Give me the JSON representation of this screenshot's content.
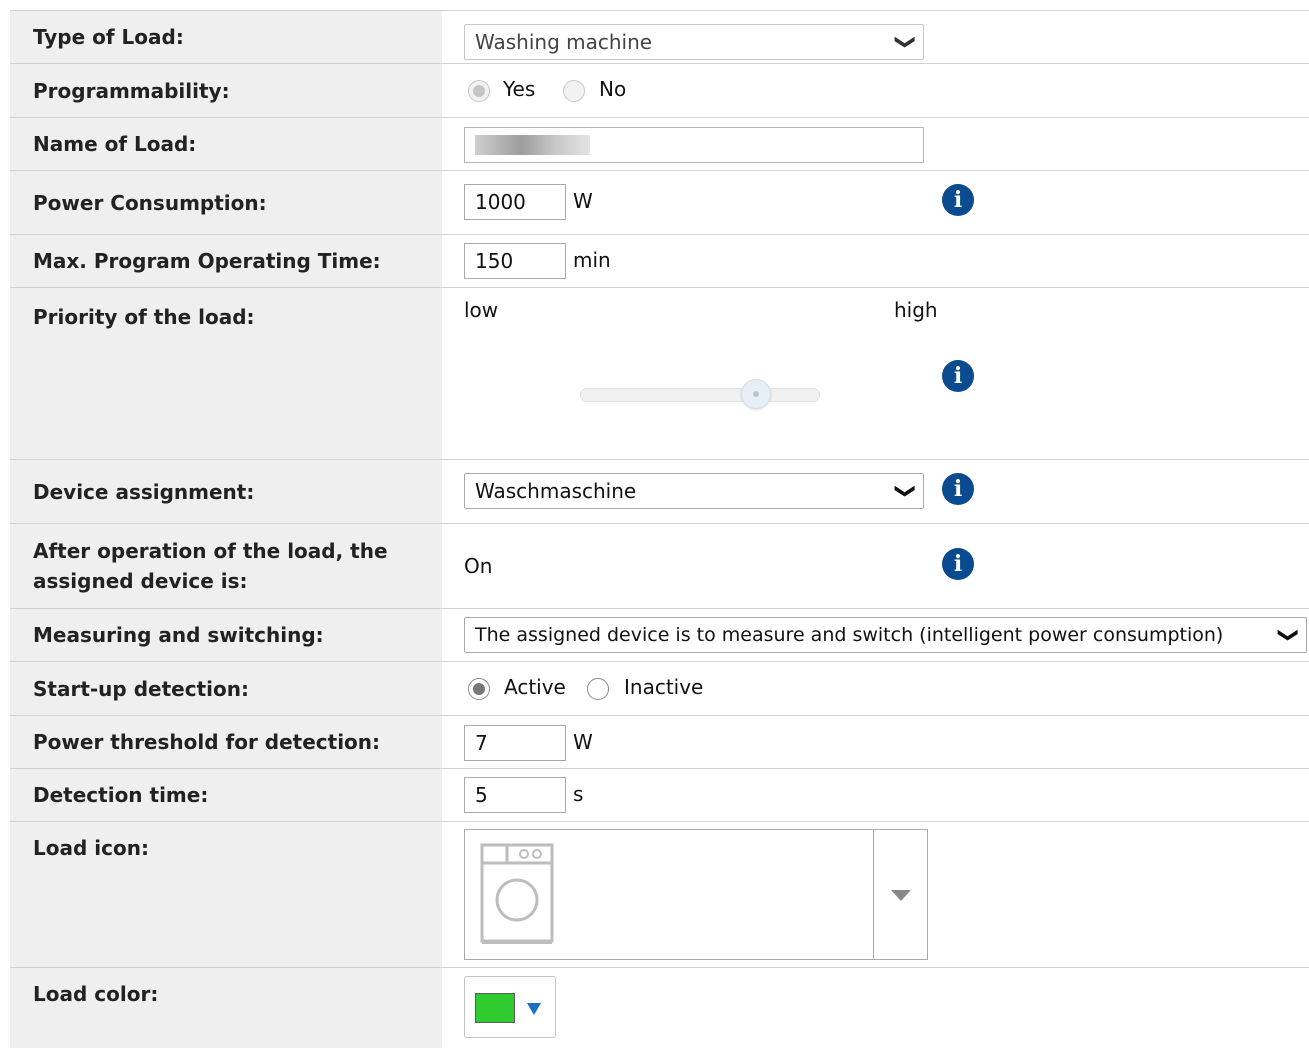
{
  "type_of_load": {
    "label": "Type of Load:",
    "value": "Washing machine"
  },
  "programmability": {
    "label": "Programmability:",
    "options": [
      "Yes",
      "No"
    ],
    "selected": "Yes",
    "disabled": true
  },
  "name_of_load": {
    "label": "Name of Load:",
    "value": ""
  },
  "power_consumption": {
    "label": "Power Consumption:",
    "value": "1000",
    "unit": "W"
  },
  "max_program_time": {
    "label": "Max. Program Operating Time:",
    "value": "150",
    "unit": "min"
  },
  "priority": {
    "label": "Priority of the load:",
    "low_label": "low",
    "high_label": "high",
    "level": 0.73
  },
  "device_assignment": {
    "label": "Device assignment:",
    "value": "Waschmaschine"
  },
  "after_operation": {
    "label_line1": "After operation of the load, the",
    "label_line2": "assigned device is:",
    "value": "On"
  },
  "measuring_switching": {
    "label": "Measuring and switching:",
    "value": "The assigned device is to measure and switch (intelligent power consumption)"
  },
  "startup_detection": {
    "label": "Start-up detection:",
    "options": [
      "Active",
      "Inactive"
    ],
    "selected": "Active"
  },
  "power_threshold": {
    "label": "Power threshold for detection:",
    "value": "7",
    "unit": "W"
  },
  "detection_time": {
    "label": "Detection time:",
    "value": "5",
    "unit": "s"
  },
  "load_icon": {
    "label": "Load icon:",
    "icon": "washing-machine-icon"
  },
  "load_color": {
    "label": "Load color:",
    "color": "#2fcc2f",
    "arrow_color": "#1a6fc4"
  },
  "info_glyph": "i",
  "chevron_glyph": "❯"
}
